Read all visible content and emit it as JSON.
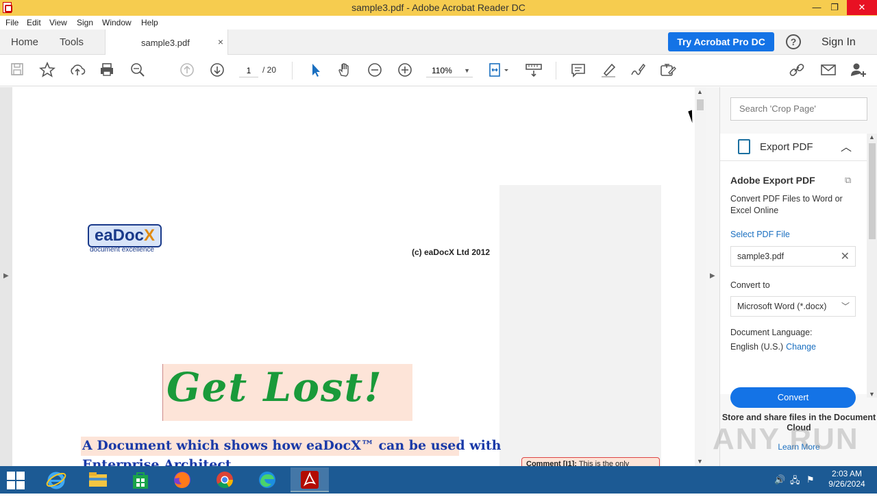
{
  "window": {
    "title": "sample3.pdf - Adobe Acrobat Reader DC",
    "minimize": "—",
    "restore": "❐",
    "close": "✕"
  },
  "menu": [
    "File",
    "Edit",
    "View",
    "Sign",
    "Window",
    "Help"
  ],
  "tabs": {
    "home": "Home",
    "tools": "Tools",
    "document": "sample3.pdf",
    "close": "×"
  },
  "header": {
    "try_pro": "Try Acrobat Pro DC",
    "help": "?",
    "sign_in": "Sign In"
  },
  "toolbar": {
    "current_page": "1",
    "total_pages": "/ 20",
    "zoom": "110%",
    "icons": [
      "save-icon",
      "star-icon",
      "upload-icon",
      "print-icon",
      "zoom-search-icon",
      "page-up-icon",
      "page-down-icon",
      "select-cursor-icon",
      "hand-icon",
      "zoom-out-icon",
      "zoom-in-icon",
      "fit-page-icon",
      "scroll-mode-icon",
      "comment-icon",
      "highlight-icon",
      "sign-icon",
      "edit-icon",
      "link-icon",
      "mail-icon",
      "add-user-icon"
    ]
  },
  "document": {
    "logo_main": "eaDoc",
    "logo_x": "X",
    "logo_sub": "document excellence",
    "copyright": "(c) eaDocX Ltd 2012",
    "headline": "Get Lost!",
    "subtitle_line1": "A Document which shows how eaDocX™ can be used with",
    "subtitle_line2": "Enterprise Architect",
    "comment_label": "Comment [I1]:",
    "comment_text": "This is the only"
  },
  "right_panel": {
    "search_placeholder": "Search 'Crop Page'",
    "section_title": "Export PDF",
    "panel_title": "Adobe Export PDF",
    "description": "Convert PDF Files to Word or Excel Online",
    "select_label": "Select PDF File",
    "selected_file": "sample3.pdf",
    "convert_to_label": "Convert to",
    "convert_format": "Microsoft Word (*.docx)",
    "language_label": "Document Language:",
    "language_value": "English (U.S.)",
    "change_link": "Change",
    "convert_button": "Convert",
    "store_text": "Store and share files in the Document Cloud",
    "learn_more": "Learn More"
  },
  "watermark": "ANY RUN",
  "taskbar": {
    "apps": [
      "internet-explorer-icon",
      "file-explorer-icon",
      "store-icon",
      "firefox-icon",
      "chrome-icon",
      "edge-icon",
      "acrobat-icon"
    ],
    "time": "2:03 AM",
    "date": "9/26/2024"
  }
}
